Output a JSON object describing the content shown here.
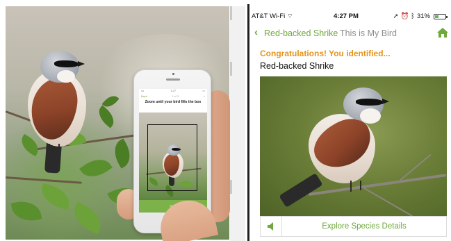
{
  "phone_screen": {
    "status_carrier": "•••",
    "status_time": "1:27",
    "status_battery": "▭",
    "nav_back": "Back",
    "nav_step": "1 of 3",
    "title": "Zoom until your bird fills the box",
    "next_label": "Next"
  },
  "app": {
    "status_bar": {
      "carrier": "AT&T Wi-Fi",
      "time": "4:27 PM",
      "battery_percent": "31%"
    },
    "nav": {
      "back_label": "Red-backed Shrike",
      "subtitle": "This is My Bird"
    },
    "result": {
      "congrats": "Congratulations! You identified...",
      "species_name": "Red-backed Shrike"
    },
    "bottom": {
      "explore_label": "Explore Species Details"
    }
  },
  "colors": {
    "accent_green": "#6fa83b",
    "congrats_orange": "#e2951e"
  },
  "icons": [
    "chevron-left-icon",
    "home-icon",
    "speaker-icon",
    "wifi-icon",
    "location-arrow-icon",
    "alarm-icon",
    "bluetooth-icon",
    "battery-icon"
  ]
}
